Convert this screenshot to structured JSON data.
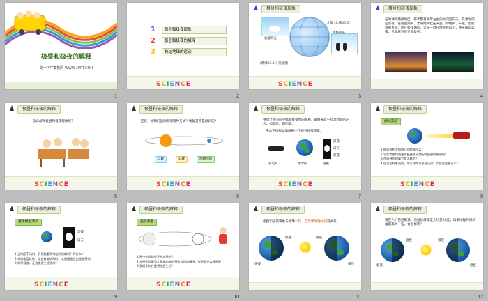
{
  "slides": [
    {
      "num": "1",
      "title": "极昼和极夜的解释",
      "subtitle": "第一PPT模板网-WWW.1PPT.COM"
    },
    {
      "num": "2",
      "toc": [
        "极昼和极夜现象",
        "极昼和极夜的解释",
        "总结地球的运动"
      ]
    },
    {
      "num": "3",
      "header": "极昼和极夜现象",
      "labels": {
        "north_pole": "北极 (北纬66.5°)",
        "north_scene": "北极风光",
        "south_scene": "南极风光",
        "south_pole": "(南纬66.5°) 南极圈"
      }
    },
    {
      "num": "4",
      "header": "极昼和极夜现象",
      "body": "在地球的两极地区，每年都有半年左右的时间是白天，其余时间是黑夜。在极昼期间，太阳始终挂在天空，即使到了午夜，也能看到太阳；而在极夜期间，太阳一直在地平线以下，整天都是黑夜，只能看到星星和极光。"
    },
    {
      "num": "5",
      "header": "极昼和极夜的解释",
      "question": "怎么解释极昼和极夜现象呢？"
    },
    {
      "num": "6",
      "header": "极昼和极夜的解释",
      "question": "回忆：地球的运动有哪两种方式？地轴是不是倾斜的？",
      "buttons": [
        "自转",
        "公转",
        "地轴倾斜"
      ]
    },
    {
      "num": "7",
      "header": "极昼和极夜的解释",
      "body": "要想让别的同学都能接受你的解释，最好采取一些现直观的方式，如实验、画图等。",
      "body2": "用以下材料试着解释一下极昼极夜现象。",
      "items": [
        "手电筒",
        "地球仪",
        "纸板"
      ],
      "labels": [
        "黑夜",
        "白天",
        "黑夜"
      ]
    },
    {
      "num": "8",
      "header": "极昼和极夜的解释",
      "badge": "模拟实验",
      "questions": [
        "1.地球仪和手电筒分别代表什么？",
        "2.怎样才能知道出现极昼是不是因为极夜的原因呢？",
        "3.在极昼的时候它是怎样的？",
        "4.应该怎样来观察，用怎样的方法在记录？实验应注意什么？"
      ]
    },
    {
      "num": "9",
      "header": "极昼和极夜的解释",
      "badge": "直观模型演示",
      "labels": [
        "黑夜",
        "白天"
      ],
      "questions": [
        "1.当地图不动时，仍然能看到地轴的倾斜吗？为什么？",
        "2.地球能否转动？绕自转轴转动时，北极圈里会出现极昼吗？",
        "3.如果极夜，让极夜发生极昼吗？"
      ]
    },
    {
      "num": "10",
      "header": "极昼和极夜的解释",
      "badge": "画示意图",
      "questions": [
        "1.图中的地球处于什么季节？",
        "2.从图中可看到北极和南极的昼夜长短的情况，说明是什么原因呢？",
        "3.我们如何在极昼地区生活？"
      ]
    },
    {
      "num": "11",
      "header": "极昼和极夜的解释",
      "body_parts": [
        "极昼和极夜现象与地球",
        {
          "t": "公转",
          "c": "#e05a1a"
        },
        "、",
        {
          "t": "自转",
          "c": "#e05a1a"
        },
        "和",
        {
          "t": "地轴倾斜",
          "c": "#e05a1a"
        },
        "有关系。"
      ],
      "labels": [
        "极昼",
        "极夜",
        "极夜",
        "极昼"
      ]
    },
    {
      "num": "12",
      "header": "极昼和极夜的解释",
      "body": "现在人们已经知道，地轴倾斜角度大约是23度，如果地轴的倾斜角度再大一些，会怎样呢？",
      "labels": [
        "极昼",
        "极夜",
        "极夜",
        "极昼"
      ]
    }
  ],
  "science": {
    "letters": [
      "S",
      "C",
      "I",
      "E",
      "N",
      "C",
      "E"
    ],
    "colors": [
      "#e74c3c",
      "#f39c12",
      "#27ae60",
      "#3498db",
      "#9b59b6",
      "#e67e22",
      "#e91e63"
    ]
  }
}
